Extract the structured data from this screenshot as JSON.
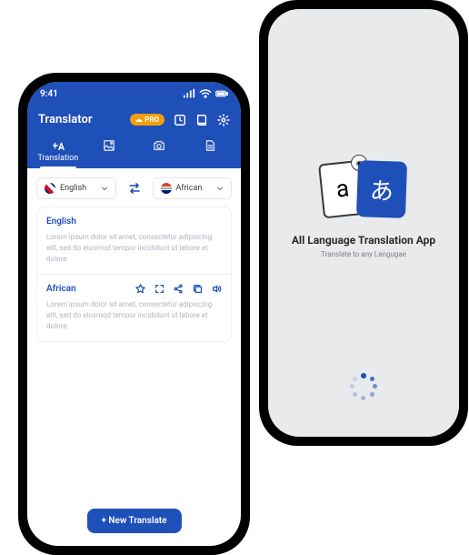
{
  "statusbar": {
    "time": "9:41"
  },
  "header": {
    "title": "Translator",
    "pro_label": "PRO"
  },
  "tabs": {
    "translation": "Translation",
    "image": "",
    "camera": "",
    "doc": ""
  },
  "lang": {
    "source": "English",
    "target": "African"
  },
  "card": {
    "source_label": "English",
    "source_text": "Lorem ipsum dolor sit amet, consectetur adipiscing elit, sed do eiusmod tempor incididunt ut labore et dolore.",
    "target_label": "African",
    "target_text": "Lorem ipsum dolor sit amet, consectetur adipiscing elit, sed do eiusmod tempor incididunt ut labore et dolore."
  },
  "new_translate": "+ New Translate",
  "splash": {
    "glyph_a": "a",
    "glyph_b": "あ",
    "title": "All Language Translation App",
    "subtitle": "Translate to any Langugae"
  }
}
